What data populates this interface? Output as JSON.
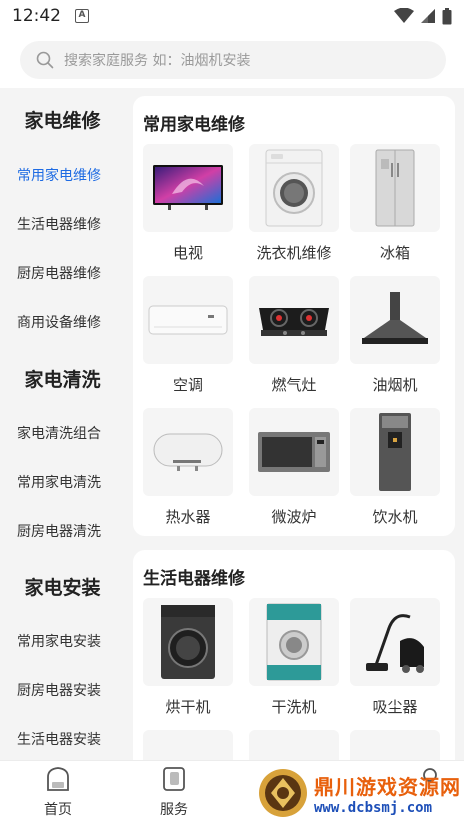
{
  "status_bar": {
    "time": "12:42",
    "notif_glyph": "A"
  },
  "search": {
    "placeholder": "搜索家庭服务 如：油烟机安装"
  },
  "sidebar": {
    "groups": [
      {
        "title": "家电维修",
        "items": [
          "常用家电维修",
          "生活电器维修",
          "厨房电器维修",
          "商用设备维修"
        ]
      },
      {
        "title": "家电清洗",
        "items": [
          "家电清洗组合",
          "常用家电清洗",
          "厨房电器清洗"
        ]
      },
      {
        "title": "家电安装",
        "items": [
          "常用家电安装",
          "厨房电器安装",
          "生活电器安装"
        ]
      }
    ],
    "active_item": "常用家电维修"
  },
  "sections": [
    {
      "title": "常用家电维修",
      "items": [
        {
          "label": "电视",
          "icon": "tv-icon"
        },
        {
          "label": "洗衣机维修",
          "icon": "washing-machine-icon"
        },
        {
          "label": "冰箱",
          "icon": "refrigerator-icon"
        },
        {
          "label": "空调",
          "icon": "air-conditioner-icon"
        },
        {
          "label": "燃气灶",
          "icon": "gas-stove-icon"
        },
        {
          "label": "油烟机",
          "icon": "range-hood-icon"
        },
        {
          "label": "热水器",
          "icon": "water-heater-icon"
        },
        {
          "label": "微波炉",
          "icon": "microwave-icon"
        },
        {
          "label": "饮水机",
          "icon": "water-dispenser-icon"
        }
      ]
    },
    {
      "title": "生活电器维修",
      "items": [
        {
          "label": "烘干机",
          "icon": "dryer-icon"
        },
        {
          "label": "干洗机",
          "icon": "dry-cleaning-machine-icon"
        },
        {
          "label": "吸尘器",
          "icon": "vacuum-cleaner-icon"
        }
      ]
    }
  ],
  "bottom_nav": [
    {
      "label": "首页",
      "icon": "home-icon"
    },
    {
      "label": "服务",
      "icon": "service-icon"
    }
  ],
  "watermark": {
    "text": "鼎川游戏资源网",
    "url": "www.dcbsmj.com"
  },
  "colors": {
    "accent": "#1e6be3",
    "background": "#f4f4f4",
    "card": "#ffffff"
  }
}
